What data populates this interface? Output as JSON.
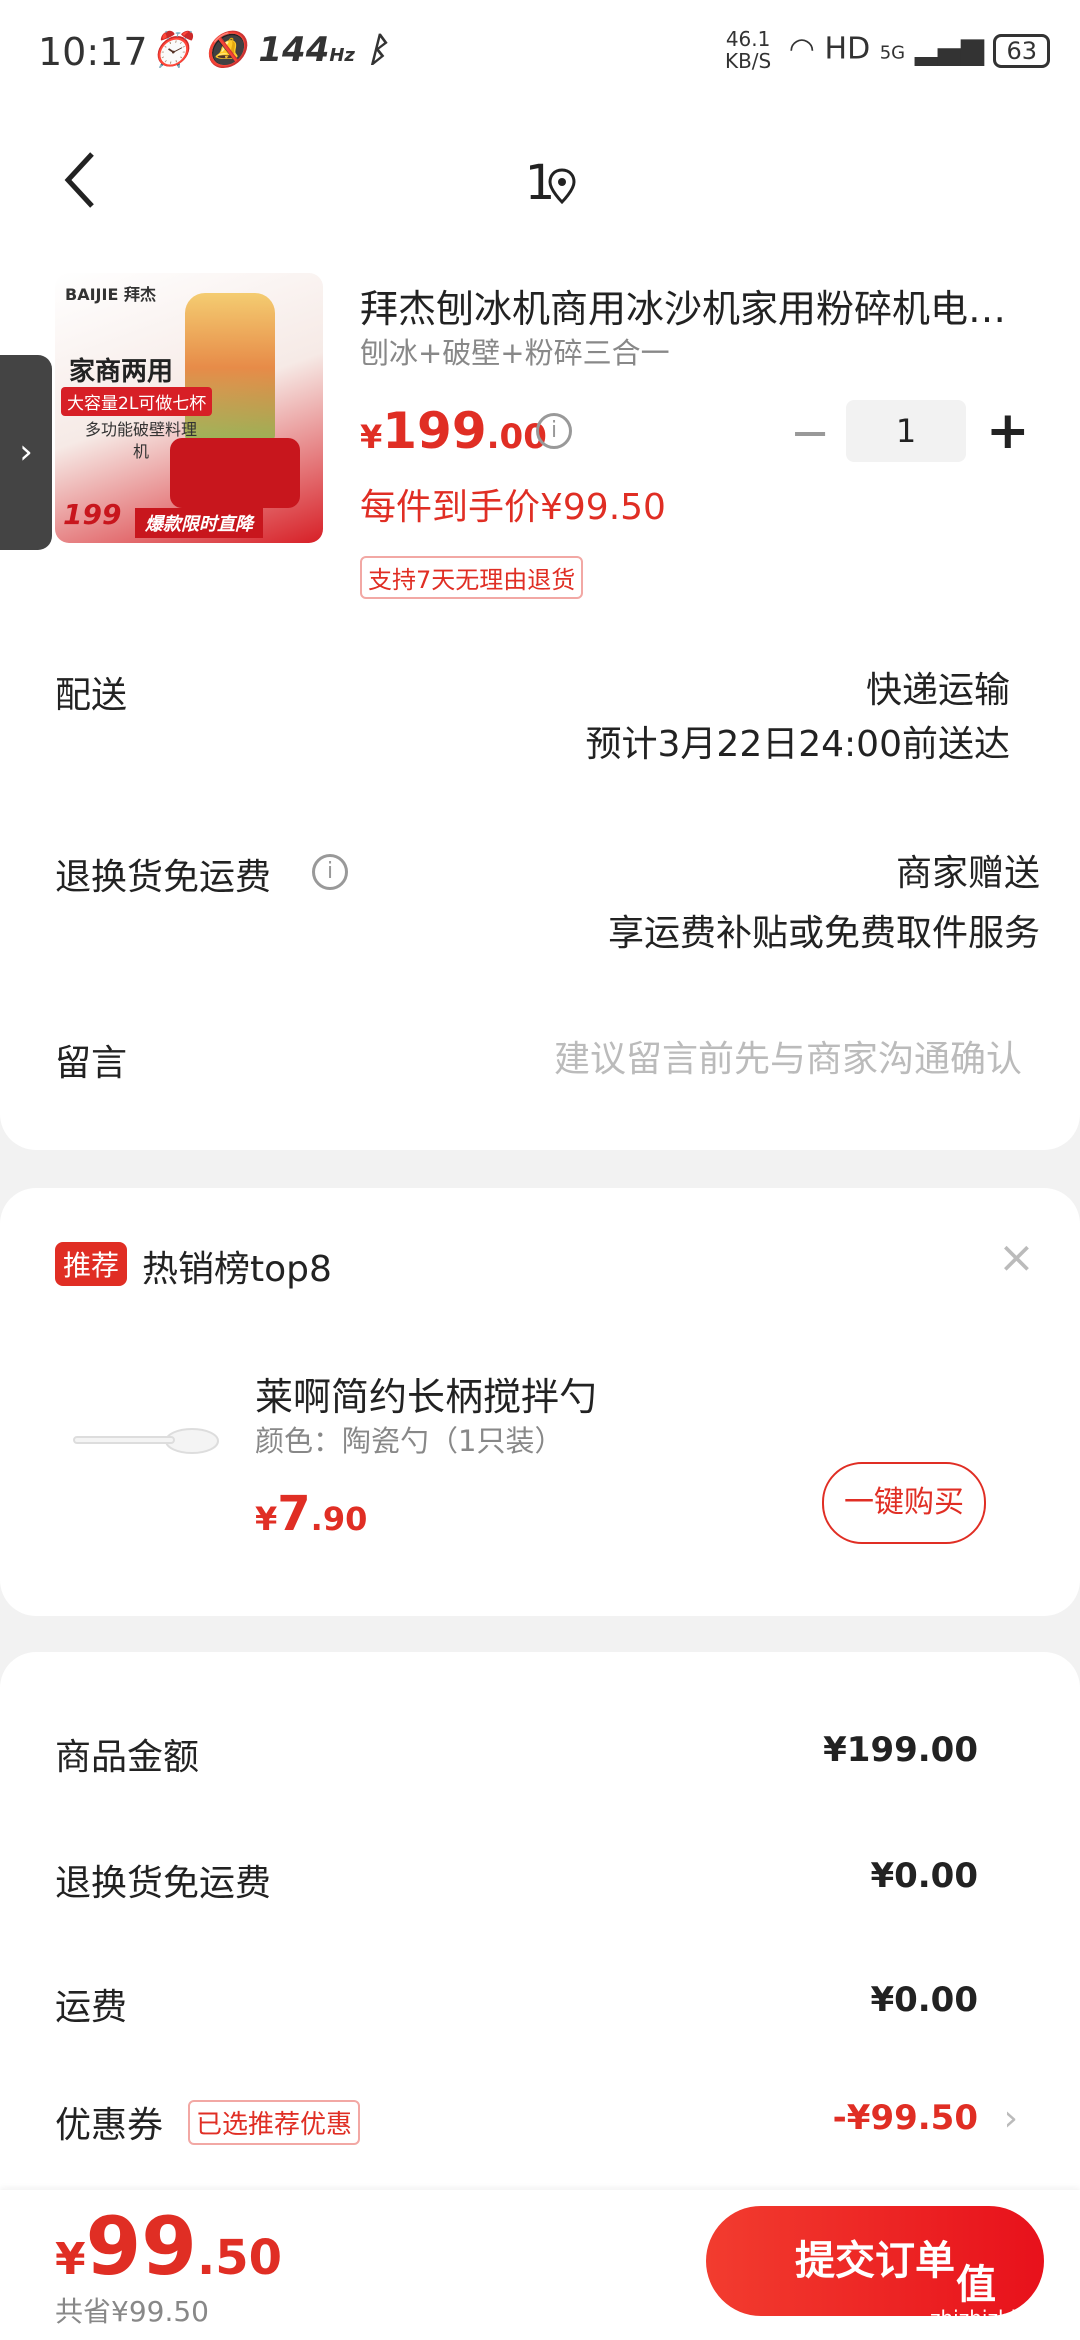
{
  "status_bar": {
    "time": "10:17",
    "refresh": "144",
    "refresh_unit": "Hz",
    "speed": "46.1",
    "speed_unit": "KB/S",
    "hd": "HD",
    "net": "5G",
    "battery": "63"
  },
  "header": {
    "back_icon": "back-chevron-icon",
    "title": "1",
    "location_icon": "location-pin-icon"
  },
  "product": {
    "image_brand": "BAIJIE 拜杰",
    "image_line1": "家商两用",
    "image_line2": "大容量2L可做七杯",
    "image_line3": "多功能破壁料理机",
    "image_price": "199",
    "image_strip": "爆款限时直降",
    "title": "拜杰刨冰机商用冰沙机家用粉碎机电…",
    "spec": "刨冰+破壁+粉碎三合一",
    "price_currency": "¥",
    "price_int": "199",
    "price_dec": ".00",
    "quantity": "1",
    "final_price": "每件到手价¥99.50",
    "return_tag": "支持7天无理由退货"
  },
  "delivery": {
    "label": "配送",
    "method": "快递运输",
    "eta": "预计3月22日24:00前送达"
  },
  "return_freight": {
    "label": "退换货免运费",
    "value1": "商家赠送",
    "value2": "享运费补贴或免费取件服务"
  },
  "message": {
    "label": "留言",
    "placeholder": "建议留言前先与商家沟通确认"
  },
  "recommend": {
    "tag": "推荐",
    "title": "热销榜top8",
    "close": "×",
    "item_name": "莱啊简约长柄搅拌勺",
    "item_spec": "颜色：陶瓷勺（1只装）",
    "item_price_currency": "¥",
    "item_price_int": "7",
    "item_price_dec": ".90",
    "buy_label": "一键购买"
  },
  "summary": {
    "goods_label": "商品金额",
    "goods_value": "¥199.00",
    "return_label": "退换货免运费",
    "return_value": "¥0.00",
    "shipping_label": "运费",
    "shipping_value": "¥0.00",
    "coupon_label": "优惠券",
    "coupon_tag": "已选推荐优惠",
    "coupon_value": "-¥99.50"
  },
  "bottom": {
    "total_currency": "¥",
    "total_int": "99",
    "total_dec": ".50",
    "saved": "共省¥99.50",
    "submit_label": "提交订单",
    "watermark": "zhizhizhi.com"
  },
  "colors": {
    "accent": "#e02e24",
    "submit_gradient_start": "#f23c2f"
  }
}
